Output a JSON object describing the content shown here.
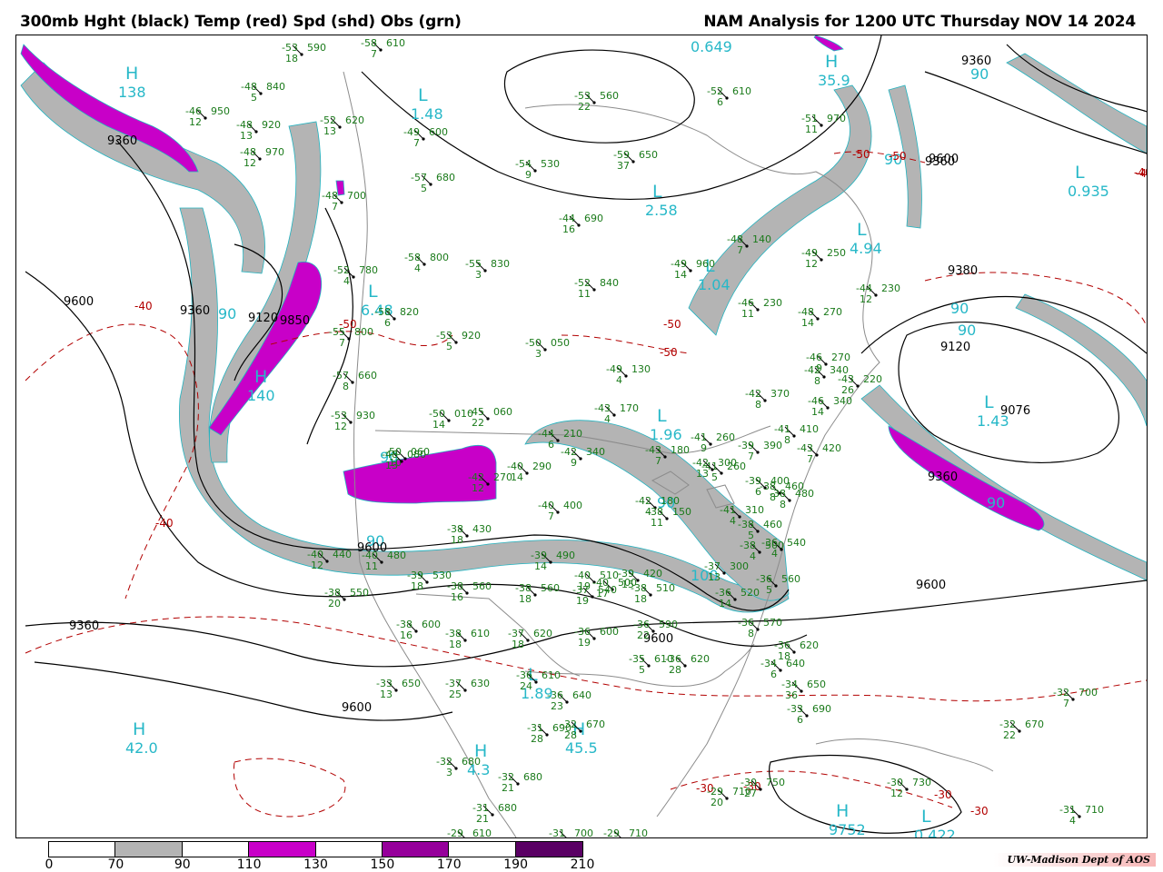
{
  "header": {
    "left_title": "300mb Hght (black) Temp (red) Spd (shd) Obs (grn)",
    "right_title": "NAM Analysis for 1200 UTC Thursday  NOV 14 2024"
  },
  "colors": {
    "height_contour": "#000000",
    "temp_contour": "#b20000",
    "obs_text": "#1a7a1a",
    "label_cyan": "#27b8c8",
    "map_lines": "#8c8c8c",
    "spd_70_90": "#b4b4b4",
    "spd_110_130": "#c800c8",
    "spd_150_170": "#96009b",
    "spd_190_210": "#5a0064"
  },
  "legend": {
    "ticks": [
      "0",
      "70",
      "90",
      "110",
      "130",
      "150",
      "170",
      "190",
      "210"
    ],
    "segments": [
      "#ffffff",
      "#b4b4b4",
      "#ffffff",
      "#c800c8",
      "#ffffff",
      "#96009b",
      "#ffffff",
      "#5a0064"
    ]
  },
  "credit": "UW-Madison   Dept of AOS",
  "pressure_centers": [
    {
      "letter": "H",
      "value": "138"
    },
    {
      "letter": "L",
      "value": "1.48"
    },
    {
      "letter": "L",
      "value": "6.48"
    },
    {
      "letter": "H",
      "value": "140"
    },
    {
      "letter": "L",
      "value": "2.58"
    },
    {
      "letter": "L",
      "value": "1.04"
    },
    {
      "letter": "L",
      "value": "4.94"
    },
    {
      "letter": "L",
      "value": "1.96"
    },
    {
      "letter": "L",
      "value": "0.935"
    },
    {
      "letter": "L",
      "value": "1.43"
    },
    {
      "letter": "H",
      "value": "42.0"
    },
    {
      "letter": "L",
      "value": "1.89"
    },
    {
      "letter": "H",
      "value": "45.5"
    },
    {
      "letter": "H",
      "value": "4.3"
    },
    {
      "letter": "L",
      "value": "0.422"
    },
    {
      "letter": "H",
      "value": "9752"
    },
    {
      "letter": "H",
      "value": "35.9"
    }
  ],
  "speed_labels": [
    "0.649",
    "90",
    "90",
    "90",
    "90",
    "90",
    "90",
    "100",
    "90",
    "90",
    "90"
  ],
  "height_labels": [
    "9360",
    "9600",
    "9360",
    "9120",
    "9850",
    "9360",
    "9600",
    "9600",
    "9360",
    "9380",
    "9120",
    "9076",
    "9360",
    "9600",
    "9360",
    "9600",
    "9600"
  ],
  "temp_labels": [
    "-40",
    "-50",
    "-40",
    "-50",
    "-50",
    "-50",
    "-30",
    "-30",
    "-40",
    "-30",
    "-30",
    "-40",
    "-50"
  ],
  "observations": [
    {
      "t": "-58",
      "h": "610",
      "d": "7"
    },
    {
      "t": "-53",
      "h": "590",
      "d": "18"
    },
    {
      "t": "-48",
      "h": "840",
      "d": "5"
    },
    {
      "t": "-46",
      "h": "950",
      "d": "12"
    },
    {
      "t": "-48",
      "h": "920",
      "d": "13"
    },
    {
      "t": "-48",
      "h": "970",
      "d": "12"
    },
    {
      "t": "-52",
      "h": "620",
      "d": "13"
    },
    {
      "t": "-48",
      "h": "700",
      "d": "7"
    },
    {
      "t": "-49",
      "h": "600",
      "d": "7"
    },
    {
      "t": "-57",
      "h": "680",
      "d": "5"
    },
    {
      "t": "-54",
      "h": "530",
      "d": "9"
    },
    {
      "t": "-59",
      "h": "650",
      "d": "37"
    },
    {
      "t": "-53",
      "h": "560",
      "d": "22"
    },
    {
      "t": "-52",
      "h": "610",
      "d": "6"
    },
    {
      "t": "-51",
      "h": "970",
      "d": "11"
    },
    {
      "t": "-48",
      "h": "140",
      "d": "7"
    },
    {
      "t": "-44",
      "h": "690",
      "d": "16"
    },
    {
      "t": "-58",
      "h": "800",
      "d": "4"
    },
    {
      "t": "-55",
      "h": "830",
      "d": "3"
    },
    {
      "t": "-52",
      "h": "840",
      "d": "11"
    },
    {
      "t": "-49",
      "h": "960",
      "d": "14"
    },
    {
      "t": "-49",
      "h": "250",
      "d": "12"
    },
    {
      "t": "-42",
      "h": "340",
      "d": "8"
    },
    {
      "t": "-52",
      "h": "780",
      "d": "4"
    },
    {
      "t": "-58",
      "h": "820",
      "d": "6"
    },
    {
      "t": "-55",
      "h": "800",
      "d": "7"
    },
    {
      "t": "-53",
      "h": "920",
      "d": "5"
    },
    {
      "t": "-50",
      "h": "050",
      "d": "3"
    },
    {
      "t": "-46",
      "h": "230",
      "d": "11"
    },
    {
      "t": "-48",
      "h": "270",
      "d": "14"
    },
    {
      "t": "-44",
      "h": "230",
      "d": "12"
    },
    {
      "t": "-57",
      "h": "660",
      "d": "8"
    },
    {
      "t": "-49",
      "h": "130",
      "d": "4"
    },
    {
      "t": "-46",
      "h": "270",
      "d": "9"
    },
    {
      "t": "-53",
      "h": "930",
      "d": "12"
    },
    {
      "t": "-50",
      "h": "010",
      "d": "14"
    },
    {
      "t": "-45",
      "h": "060",
      "d": "22"
    },
    {
      "t": "-43",
      "h": "170",
      "d": "4"
    },
    {
      "t": "-42",
      "h": "370",
      "d": "8"
    },
    {
      "t": "-43",
      "h": "220",
      "d": "26"
    },
    {
      "t": "-46",
      "h": "340",
      "d": "14"
    },
    {
      "t": "-50",
      "h": "060",
      "d": "10"
    },
    {
      "t": "-48",
      "h": "080",
      "d": "13"
    },
    {
      "t": "-44",
      "h": "210",
      "d": "6"
    },
    {
      "t": "-41",
      "h": "260",
      "d": "9"
    },
    {
      "t": "-43",
      "h": "180",
      "d": "7"
    },
    {
      "t": "-41",
      "h": "260",
      "d": "5"
    },
    {
      "t": "-39",
      "h": "390",
      "d": "7"
    },
    {
      "t": "-41",
      "h": "410",
      "d": "8"
    },
    {
      "t": "-43",
      "h": "420",
      "d": "7"
    },
    {
      "t": "-42",
      "h": "300",
      "d": "13"
    },
    {
      "t": "-39",
      "h": "400",
      "d": "6"
    },
    {
      "t": "-38",
      "h": "460",
      "d": "8"
    },
    {
      "t": "-38",
      "h": "480",
      "d": "8"
    },
    {
      "t": "-42",
      "h": "270",
      "d": "12"
    },
    {
      "t": "-40",
      "h": "290",
      "d": "14"
    },
    {
      "t": "-42",
      "h": "340",
      "d": "9"
    },
    {
      "t": "-40",
      "h": "400",
      "d": "7"
    },
    {
      "t": "-42",
      "h": "180",
      "d": "4"
    },
    {
      "t": "-38",
      "h": "150",
      "d": "11"
    },
    {
      "t": "-41",
      "h": "310",
      "d": "4"
    },
    {
      "t": "-38",
      "h": "460",
      "d": "5"
    },
    {
      "t": "-38",
      "h": "500",
      "d": "4"
    },
    {
      "t": "-36",
      "h": "540",
      "d": "4"
    },
    {
      "t": "-38",
      "h": "430",
      "d": "18"
    },
    {
      "t": "-40",
      "h": "440",
      "d": "12"
    },
    {
      "t": "-40",
      "h": "480",
      "d": "11"
    },
    {
      "t": "-39",
      "h": "530",
      "d": "18"
    },
    {
      "t": "-39",
      "h": "490",
      "d": "14"
    },
    {
      "t": "-40",
      "h": "510",
      "d": "19"
    },
    {
      "t": "-40",
      "h": "500",
      "d": "17"
    },
    {
      "t": "-39",
      "h": "420",
      "d": "15"
    },
    {
      "t": "-37",
      "h": "300",
      "d": "13"
    },
    {
      "t": "-36",
      "h": "520",
      "d": "14"
    },
    {
      "t": "-38",
      "h": "550",
      "d": "20"
    },
    {
      "t": "-38",
      "h": "560",
      "d": "16"
    },
    {
      "t": "-38",
      "h": "560",
      "d": "18"
    },
    {
      "t": "-37",
      "h": "540",
      "d": "19"
    },
    {
      "t": "-38",
      "h": "510",
      "d": "18"
    },
    {
      "t": "-36",
      "h": "560",
      "d": "5"
    },
    {
      "t": "-38",
      "h": "600",
      "d": "16"
    },
    {
      "t": "-38",
      "h": "610",
      "d": "18"
    },
    {
      "t": "-37",
      "h": "620",
      "d": "18"
    },
    {
      "t": "-36",
      "h": "600",
      "d": "19"
    },
    {
      "t": "-36",
      "h": "590",
      "d": "22"
    },
    {
      "t": "-36",
      "h": "570",
      "d": "8"
    },
    {
      "t": "-35",
      "h": "610",
      "d": "5"
    },
    {
      "t": "-36",
      "h": "620",
      "d": "28"
    },
    {
      "t": "-36",
      "h": "620",
      "d": "18"
    },
    {
      "t": "-34",
      "h": "640",
      "d": "6"
    },
    {
      "t": "-33",
      "h": "650",
      "d": "13"
    },
    {
      "t": "-37",
      "h": "630",
      "d": "25"
    },
    {
      "t": "-36",
      "h": "610",
      "d": "24"
    },
    {
      "t": "-36",
      "h": "640",
      "d": "23"
    },
    {
      "t": "-34",
      "h": "650",
      "d": "36"
    },
    {
      "t": "-33",
      "h": "690",
      "d": "6"
    },
    {
      "t": "-32",
      "h": "700",
      "d": "7"
    },
    {
      "t": "-31",
      "h": "690",
      "d": "28"
    },
    {
      "t": "-32",
      "h": "670",
      "d": "28"
    },
    {
      "t": "-32",
      "h": "670",
      "d": "22"
    },
    {
      "t": "-32",
      "h": "680",
      "d": "3"
    },
    {
      "t": "-32",
      "h": "680",
      "d": "21"
    },
    {
      "t": "-31",
      "h": "680",
      "d": "21"
    },
    {
      "t": "-29",
      "h": "710",
      "d": "20"
    },
    {
      "t": "-30",
      "h": "750",
      "d": "27"
    },
    {
      "t": "-30",
      "h": "730",
      "d": "12"
    },
    {
      "t": "-31",
      "h": "710",
      "d": "4"
    },
    {
      "t": "-31",
      "h": "700",
      "d": "18"
    },
    {
      "t": "-29",
      "h": "610",
      "d": "19"
    },
    {
      "t": "-29",
      "h": "710",
      "d": "2"
    },
    {
      "t": "-30",
      "h": "720",
      "d": "7"
    }
  ]
}
